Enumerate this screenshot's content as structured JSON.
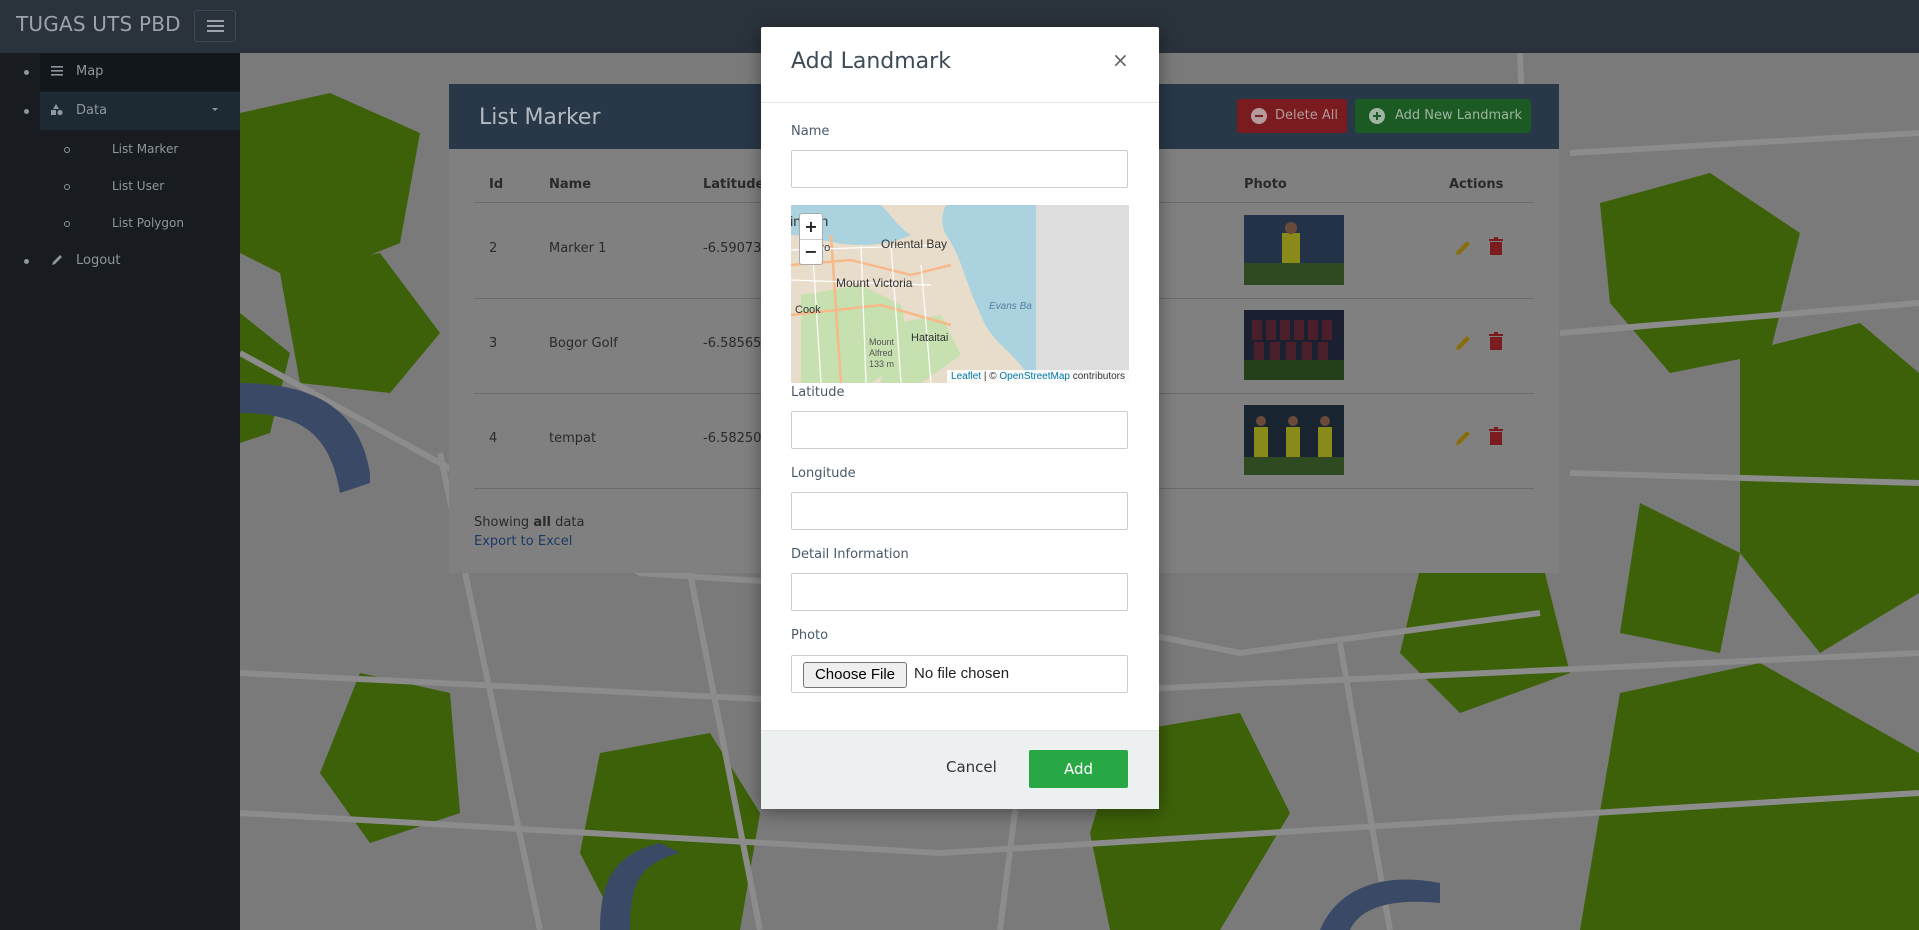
{
  "navbar": {
    "brand": "TUGAS UTS PBD",
    "toggle_icon": "hamburger-icon"
  },
  "sidebar": {
    "items": [
      {
        "label": "Map",
        "icon": "list-icon"
      },
      {
        "label": "Data",
        "icon": "shapes-icon",
        "expanded": true
      },
      {
        "label": "Logout",
        "icon": "pencil-icon"
      }
    ],
    "sub_items": [
      {
        "label": "List Marker"
      },
      {
        "label": "List User"
      },
      {
        "label": "List Polygon"
      }
    ]
  },
  "panel": {
    "title": "List Marker",
    "delete_all_label": "Delete All",
    "add_new_label": "Add New Landmark",
    "columns": {
      "id": "Id",
      "name": "Name",
      "latitude": "Latitude",
      "photo": "Photo",
      "actions": "Actions"
    },
    "rows": [
      {
        "id": "2",
        "name": "Marker 1",
        "latitude": "-6.59073"
      },
      {
        "id": "3",
        "name": "Bogor Golf",
        "latitude": "-6.58565"
      },
      {
        "id": "4",
        "name": "tempat",
        "latitude": "-6.58250"
      }
    ],
    "footer_prefix": "Showing ",
    "footer_bold": "all",
    "footer_suffix": " data",
    "export_label": "Export to Excel"
  },
  "modal": {
    "title": "Add Landmark",
    "close_glyph": "×",
    "fields": {
      "name": {
        "label": "Name",
        "value": ""
      },
      "latitude": {
        "label": "Latitude",
        "value": ""
      },
      "longitude": {
        "label": "Longitude",
        "value": ""
      },
      "detail": {
        "label": "Detail Information",
        "value": ""
      },
      "photo": {
        "label": "Photo",
        "button": "Choose File",
        "status": "No file chosen"
      }
    },
    "map": {
      "zoom_in": "+",
      "zoom_out": "−",
      "labels": [
        "lington",
        "Te Aro",
        "Oriental Bay",
        "Mount Victoria",
        "Cook",
        "Evans Ba",
        "Hataitai",
        "Mount",
        "Alfred",
        "133 m"
      ],
      "attribution_leaflet": "Leaflet",
      "attribution_sep": " | © ",
      "attribution_osm": "OpenStreetMap",
      "attribution_suffix": " contributors"
    },
    "cancel_label": "Cancel",
    "add_label": "Add"
  },
  "colors": {
    "add_green": "#28a745",
    "delete_red": "#dc3545",
    "header_navy": "#2c3e50"
  }
}
